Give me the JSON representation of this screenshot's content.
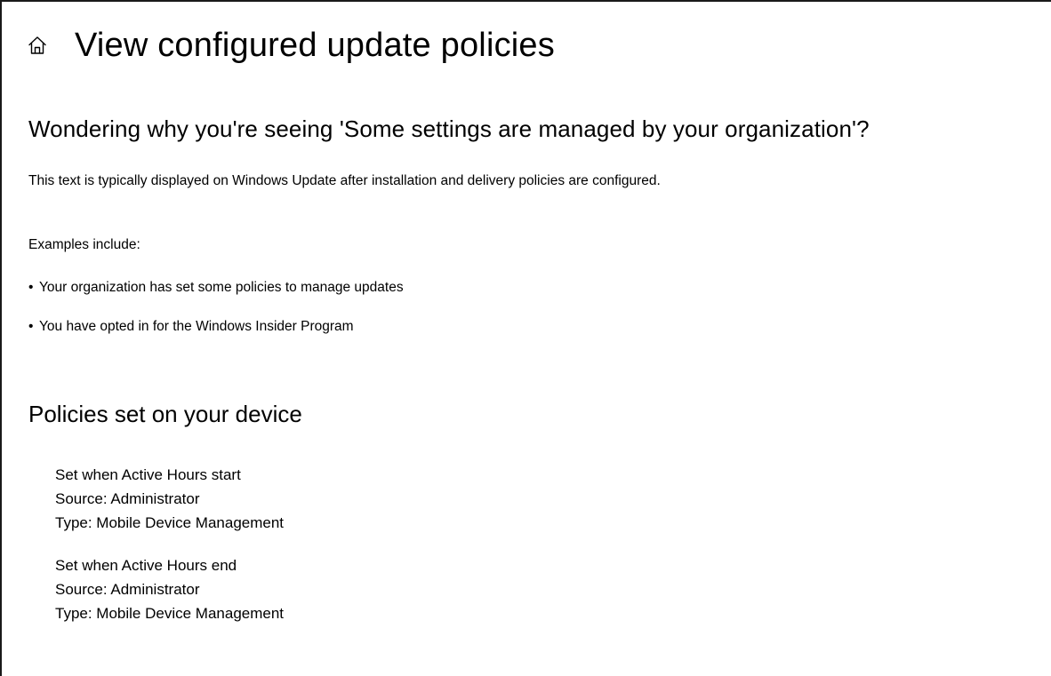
{
  "header": {
    "home_icon": "home-icon",
    "title": "View configured update policies"
  },
  "intro": {
    "heading": "Wondering why you're seeing 'Some settings are managed by your organization'?",
    "description": "This text is typically displayed on Windows Update after installation and delivery policies are configured.",
    "examples_label": "Examples include:",
    "examples": [
      "Your organization has set some policies to manage updates",
      "You have opted in for the Windows Insider Program"
    ]
  },
  "policies": {
    "heading": "Policies set on your device",
    "items": [
      {
        "name": "Set when Active Hours start",
        "source": "Source: Administrator",
        "type": "Type: Mobile Device Management"
      },
      {
        "name": "Set when Active Hours end",
        "source": "Source: Administrator",
        "type": "Type: Mobile Device Management"
      }
    ]
  }
}
